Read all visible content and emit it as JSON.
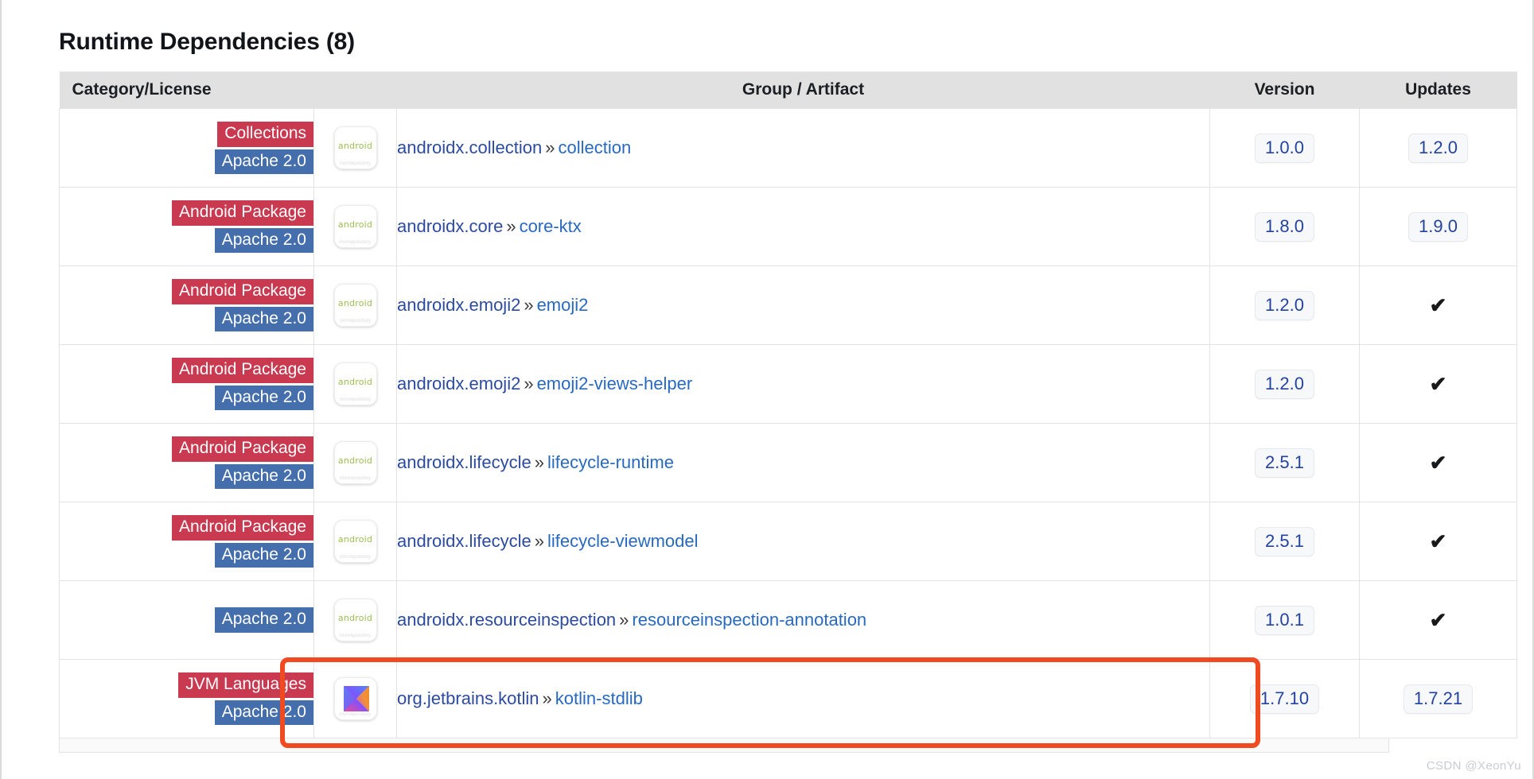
{
  "page": {
    "title": "Runtime Dependencies (8)",
    "watermark": "CSDN @XeonYu"
  },
  "colors": {
    "category_badge": "#c9394f",
    "license_badge": "#456ead",
    "version_text": "#24439e",
    "group_link": "#2c4ba0",
    "artifact_link": "#2869c0",
    "header_bg": "#e1e1e1",
    "highlight_box": "#f04a20",
    "android_green": "#9bbf4f"
  },
  "table": {
    "headers": {
      "category": "Category/License",
      "icon": "",
      "group_artifact": "Group / Artifact",
      "version": "Version",
      "updates": "Updates"
    },
    "separator": "»",
    "check_glyph": "✔",
    "icon_android_label": "android",
    "icon_watermark_label": "mvnrepository",
    "rows": [
      {
        "category": "Collections",
        "license": "Apache 2.0",
        "icon": "android-icon",
        "group": "androidx.collection",
        "artifact": "collection",
        "version": "1.0.0",
        "update": "1.2.0",
        "update_is_check": false,
        "highlighted": false
      },
      {
        "category": "Android Package",
        "license": "Apache 2.0",
        "icon": "android-icon",
        "group": "androidx.core",
        "artifact": "core-ktx",
        "version": "1.8.0",
        "update": "1.9.0",
        "update_is_check": false,
        "highlighted": false
      },
      {
        "category": "Android Package",
        "license": "Apache 2.0",
        "icon": "android-icon",
        "group": "androidx.emoji2",
        "artifact": "emoji2",
        "version": "1.2.0",
        "update": "✔",
        "update_is_check": true,
        "highlighted": false
      },
      {
        "category": "Android Package",
        "license": "Apache 2.0",
        "icon": "android-icon",
        "group": "androidx.emoji2",
        "artifact": "emoji2-views-helper",
        "version": "1.2.0",
        "update": "✔",
        "update_is_check": true,
        "highlighted": false
      },
      {
        "category": "Android Package",
        "license": "Apache 2.0",
        "icon": "android-icon",
        "group": "androidx.lifecycle",
        "artifact": "lifecycle-runtime",
        "version": "2.5.1",
        "update": "✔",
        "update_is_check": true,
        "highlighted": false
      },
      {
        "category": "Android Package",
        "license": "Apache 2.0",
        "icon": "android-icon",
        "group": "androidx.lifecycle",
        "artifact": "lifecycle-viewmodel",
        "version": "2.5.1",
        "update": "✔",
        "update_is_check": true,
        "highlighted": false
      },
      {
        "category": "",
        "license": "Apache 2.0",
        "icon": "android-icon",
        "group": "androidx.resourceinspection",
        "artifact": "resourceinspection-annotation",
        "version": "1.0.1",
        "update": "✔",
        "update_is_check": true,
        "highlighted": false
      },
      {
        "category": "JVM Languages",
        "license": "Apache 2.0",
        "icon": "kotlin-icon",
        "group": "org.jetbrains.kotlin",
        "artifact": "kotlin-stdlib",
        "version": "1.7.10",
        "update": "1.7.21",
        "update_is_check": false,
        "highlighted": true
      }
    ]
  }
}
